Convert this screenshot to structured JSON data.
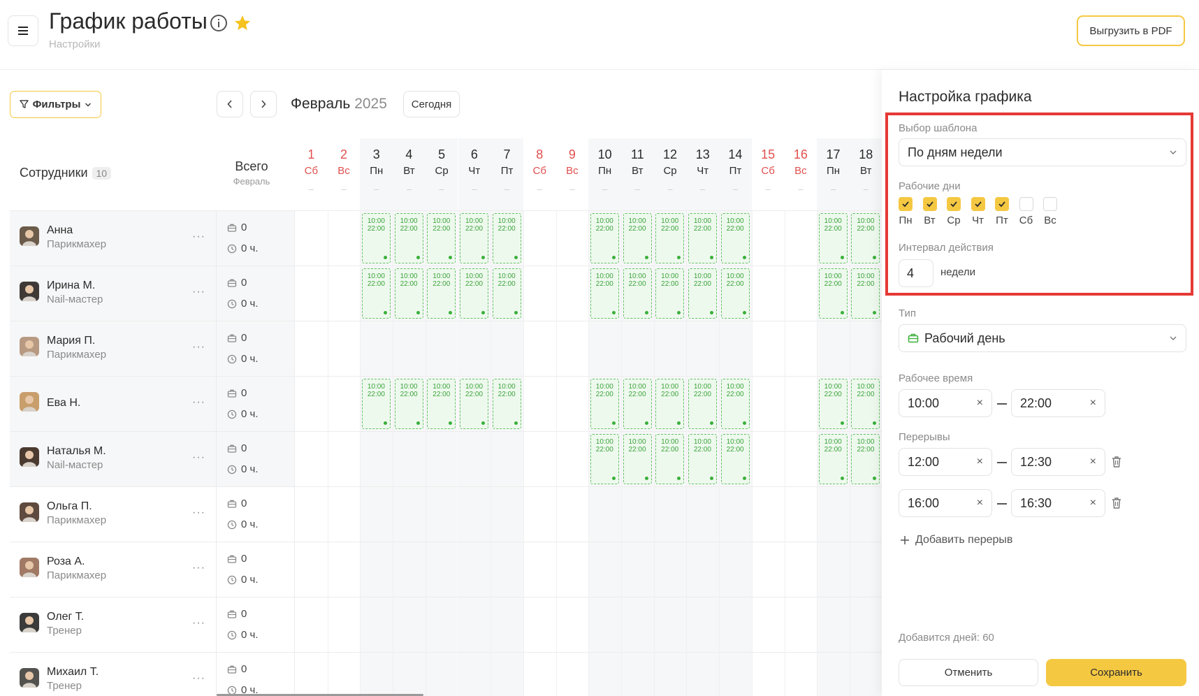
{
  "header": {
    "title": "График работы",
    "breadcrumb": "Настройки",
    "export_label": "Выгрузить в PDF"
  },
  "toolbar": {
    "filters_label": "Фильтры",
    "month": "Февраль",
    "year": "2025",
    "today_label": "Сегодня"
  },
  "table": {
    "employees_label": "Сотрудники",
    "employees_count": "10",
    "total_label": "Всего",
    "total_sub": "Февраль",
    "days": [
      {
        "num": "1",
        "wd": "Сб",
        "weekend": true
      },
      {
        "num": "2",
        "wd": "Вс",
        "weekend": true
      },
      {
        "num": "3",
        "wd": "Пн",
        "weekend": false
      },
      {
        "num": "4",
        "wd": "Вт",
        "weekend": false
      },
      {
        "num": "5",
        "wd": "Ср",
        "weekend": false
      },
      {
        "num": "6",
        "wd": "Чт",
        "weekend": false
      },
      {
        "num": "7",
        "wd": "Пт",
        "weekend": false
      },
      {
        "num": "8",
        "wd": "Сб",
        "weekend": true
      },
      {
        "num": "9",
        "wd": "Вс",
        "weekend": true
      },
      {
        "num": "10",
        "wd": "Пн",
        "weekend": false
      },
      {
        "num": "11",
        "wd": "Вт",
        "weekend": false
      },
      {
        "num": "12",
        "wd": "Ср",
        "weekend": false
      },
      {
        "num": "13",
        "wd": "Чт",
        "weekend": false
      },
      {
        "num": "14",
        "wd": "Пт",
        "weekend": false
      },
      {
        "num": "15",
        "wd": "Сб",
        "weekend": true
      },
      {
        "num": "16",
        "wd": "Вс",
        "weekend": true
      },
      {
        "num": "17",
        "wd": "Пн",
        "weekend": false
      },
      {
        "num": "18",
        "wd": "Вт",
        "weekend": false
      }
    ],
    "day_dash": "–",
    "employees": [
      {
        "name": "Анна",
        "role": "Парикмахер",
        "count": "0",
        "hours": "0 ч.",
        "shifts": [
          3,
          4,
          5,
          6,
          7,
          10,
          11,
          12,
          13,
          14,
          17,
          18
        ]
      },
      {
        "name": "Ирина М.",
        "role": "Nail-мастер",
        "count": "0",
        "hours": "0 ч.",
        "shifts": [
          3,
          4,
          5,
          6,
          7,
          10,
          11,
          12,
          13,
          14,
          17,
          18
        ]
      },
      {
        "name": "Мария П.",
        "role": "Парикмахер",
        "count": "0",
        "hours": "0 ч.",
        "shifts": []
      },
      {
        "name": "Ева Н.",
        "role": "",
        "count": "0",
        "hours": "0 ч.",
        "shifts": [
          3,
          4,
          5,
          6,
          7,
          10,
          11,
          12,
          13,
          14,
          17,
          18
        ]
      },
      {
        "name": "Наталья М.",
        "role": "Nail-мастер",
        "count": "0",
        "hours": "0 ч.",
        "shifts": [
          10,
          11,
          12,
          13,
          14,
          17,
          18
        ]
      },
      {
        "name": "Ольга П.",
        "role": "Парикмахер",
        "count": "0",
        "hours": "0 ч.",
        "shifts": []
      },
      {
        "name": "Роза А.",
        "role": "Парикмахер",
        "count": "0",
        "hours": "0 ч.",
        "shifts": []
      },
      {
        "name": "Олег Т.",
        "role": "Тренер",
        "count": "0",
        "hours": "0 ч.",
        "shifts": []
      },
      {
        "name": "Михаил Т.",
        "role": "Тренер",
        "count": "0",
        "hours": "0 ч.",
        "shifts": []
      }
    ],
    "shift_start": "10:00",
    "shift_end": "22:00",
    "more_label": "···"
  },
  "panel": {
    "title": "Настройка графика",
    "template_label": "Выбор шаблона",
    "template_value": "По дням недели",
    "workdays_label": "Рабочие дни",
    "workdays": [
      {
        "label": "Пн",
        "checked": true
      },
      {
        "label": "Вт",
        "checked": true
      },
      {
        "label": "Ср",
        "checked": true
      },
      {
        "label": "Чт",
        "checked": true
      },
      {
        "label": "Пт",
        "checked": true
      },
      {
        "label": "Сб",
        "checked": false
      },
      {
        "label": "Вс",
        "checked": false
      }
    ],
    "interval_label": "Интервал действия",
    "interval_value": "4",
    "interval_unit": "недели",
    "type_label": "Тип",
    "type_value": "Рабочий день",
    "worktime_label": "Рабочее время",
    "worktime_from": "10:00",
    "worktime_to": "22:00",
    "breaks_label": "Перерывы",
    "breaks": [
      {
        "from": "12:00",
        "to": "12:30"
      },
      {
        "from": "16:00",
        "to": "16:30"
      }
    ],
    "add_break_label": "Добавить перерыв",
    "days_added": "Добавится дней: 60",
    "cancel_label": "Отменить",
    "save_label": "Сохранить"
  },
  "colors": {
    "accent": "#f5c842",
    "weekend": "#e0504f",
    "shift_border": "#62c262",
    "highlight": "#e53935"
  }
}
